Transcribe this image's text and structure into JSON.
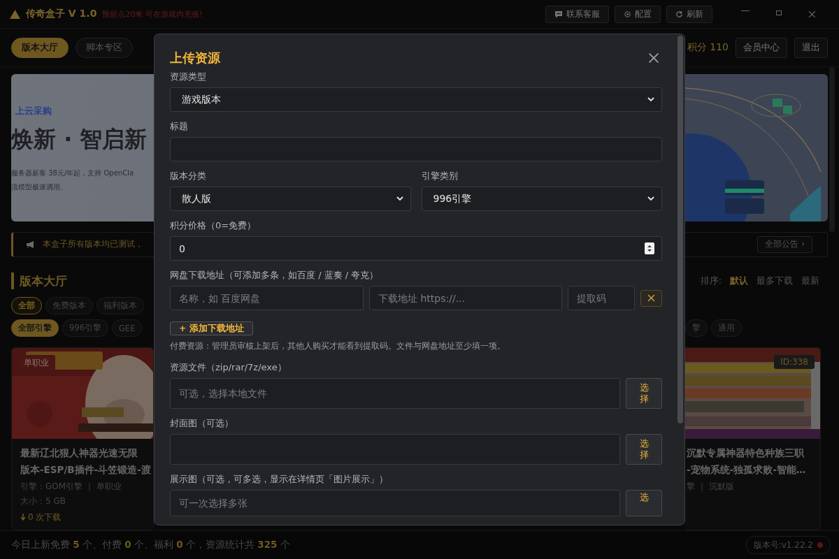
{
  "title_bar": {
    "app_name": "传奇盒子 V 1.0",
    "notice": "预留点20米 可在游戏内充值!",
    "buttons": [
      "联系客服",
      "配置",
      "刷新"
    ]
  },
  "nav": {
    "tabs": [
      {
        "label": "版本大厅",
        "selected": true
      },
      {
        "label": "脚本专区",
        "selected": false
      }
    ],
    "points": "积分 110",
    "buttons": [
      "会员中心",
      "退出"
    ]
  },
  "banner": {
    "brand": "上云采购",
    "headline": "焕新 · 智启新",
    "lines": [
      "服务器新客 38元/年起，支持 OpenCla",
      "流模型极速调用。"
    ]
  },
  "notice": {
    "text": "本盒子所有版本均已测试，",
    "more": "全部公告 ›"
  },
  "section": {
    "title": "版本大厅",
    "sort_label": "排序:",
    "sort_options": [
      {
        "label": "默认",
        "selected": true
      },
      {
        "label": "最多下载",
        "selected": false
      },
      {
        "label": "最新",
        "selected": false
      }
    ]
  },
  "type_filters": [
    {
      "label": "全部",
      "selected": true
    },
    {
      "label": "免费版本",
      "selected": false
    },
    {
      "label": "福利版本",
      "selected": false
    }
  ],
  "engine_filters": {
    "left": [
      {
        "label": "全部引擎",
        "selected": true
      },
      {
        "label": "996引擎",
        "selected": false
      },
      {
        "label": "GEE",
        "selected": false
      }
    ],
    "right": [
      {
        "label": "擎",
        "selected": false
      },
      {
        "label": "通用",
        "selected": false
      }
    ]
  },
  "cards": [
    {
      "badge": "单职业",
      "title": [
        "最新辽北狠人神器光速无限",
        "版本-ESP/B插件-斗笠锻造-渡"
      ],
      "meta": "引擎：GOM引擎 ｜ 单职业",
      "size": "大小：5 GB",
      "downloads": "0 次下载"
    },
    {
      "badge": "ID:338",
      "title": [
        "沉默专属神器特色种族三职",
        "-宠物系统-独孤求败-智能…"
      ],
      "meta": "擎 ｜ 沉默版"
    }
  ],
  "modal": {
    "title": "上传资源",
    "fields": [
      {
        "kind": "select",
        "label": "资源类型",
        "value": "游戏版本"
      },
      {
        "kind": "text",
        "label": "标题"
      },
      {
        "kind": "select_pair",
        "items": [
          {
            "label": "版本分类",
            "value": "散人版"
          },
          {
            "label": "引擎类别",
            "value": "996引擎"
          }
        ]
      },
      {
        "kind": "number",
        "label": "积分价格（0=免费）",
        "value": "0"
      },
      {
        "kind": "links",
        "label": "网盘下载地址（可添加多条，如百度 / 蓝奏 / 夸克）",
        "placeholders": [
          "名称，如 百度网盘",
          "下载地址 https://...",
          "提取码"
        ],
        "add": "+ 添加下载地址",
        "hint": "付费资源：管理员审核上架后，其他人购买才能看到提取码。文件与网盘地址至少填一项。"
      },
      {
        "kind": "file",
        "label": "资源文件（zip/rar/7z/exe）",
        "placeholder": "可选，选择本地文件",
        "button": "选择"
      },
      {
        "kind": "file",
        "label": "封面图（可选）",
        "button": "选择"
      },
      {
        "kind": "file",
        "label": "展示图（可选，可多选，显示在详情页「图片展示」）",
        "placeholder": "可一次选择多张",
        "button": "选"
      }
    ]
  },
  "status_bar": {
    "summary": "今日上新免费 **5** 个、付费 **0** 个、福利 **0** 个，资源统计共 **325** 个",
    "version": "版本号:v1.22.2"
  }
}
